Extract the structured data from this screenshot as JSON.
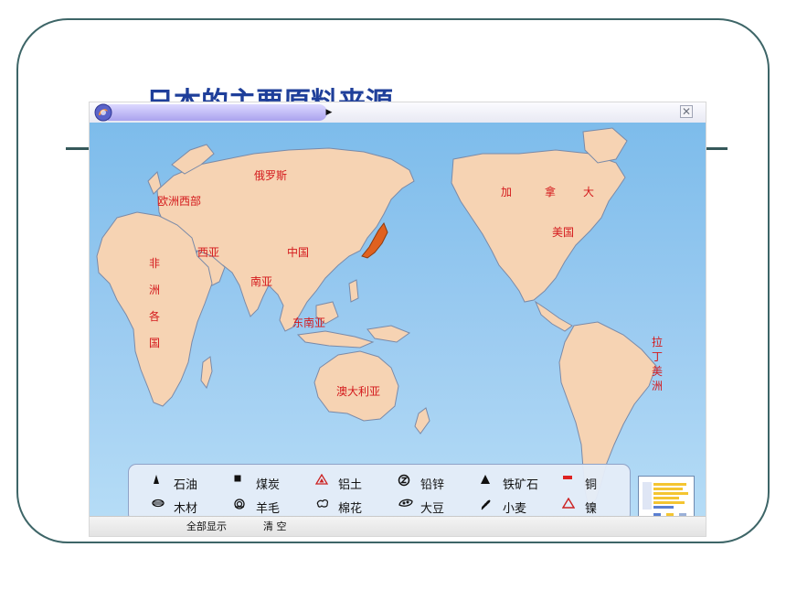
{
  "slide": {
    "title": "日本的主要原料来源"
  },
  "window": {
    "close_glyph": "✕",
    "arrow_glyph": "▶"
  },
  "regions": {
    "europe_west": "欧洲西部",
    "russia": "俄罗斯",
    "west_asia": "西亚",
    "china": "中国",
    "south_asia": "南亚",
    "southeast_asia": "东南亚",
    "africa": "非洲各国",
    "australia": "澳大利亚",
    "canada_1": "加",
    "canada_2": "拿",
    "canada_3": "大",
    "usa": "美国",
    "latin_america": "拉丁美洲"
  },
  "legend": [
    {
      "label": "石油",
      "icon": "oil-icon",
      "color": "#111111"
    },
    {
      "label": "煤炭",
      "icon": "coal-icon",
      "color": "#111111"
    },
    {
      "label": "铝土",
      "icon": "bauxite-icon",
      "color": "#cc2222"
    },
    {
      "label": "铅锌",
      "icon": "lead-zinc-icon",
      "color": "#111111"
    },
    {
      "label": "铁矿石",
      "icon": "iron-ore-icon",
      "color": "#111111"
    },
    {
      "label": "铜",
      "icon": "copper-icon",
      "color": "#dd2222"
    },
    {
      "label": "木材",
      "icon": "timber-icon",
      "color": "#111111"
    },
    {
      "label": "羊毛",
      "icon": "wool-icon",
      "color": "#111111"
    },
    {
      "label": "棉花",
      "icon": "cotton-icon",
      "color": "#111111"
    },
    {
      "label": "大豆",
      "icon": "soybean-icon",
      "color": "#111111"
    },
    {
      "label": "小麦",
      "icon": "wheat-icon",
      "color": "#111111"
    },
    {
      "label": "镍",
      "icon": "nickel-icon",
      "color": "#cc2222"
    }
  ],
  "statusbar": {
    "show_all": "全部显示",
    "clear": "清 空"
  },
  "colors": {
    "ocean": "#8ec6ee",
    "land": "#f6d3b3",
    "japan": "#e0611f",
    "frame": "#3d6567",
    "title": "#1f3f9a"
  }
}
